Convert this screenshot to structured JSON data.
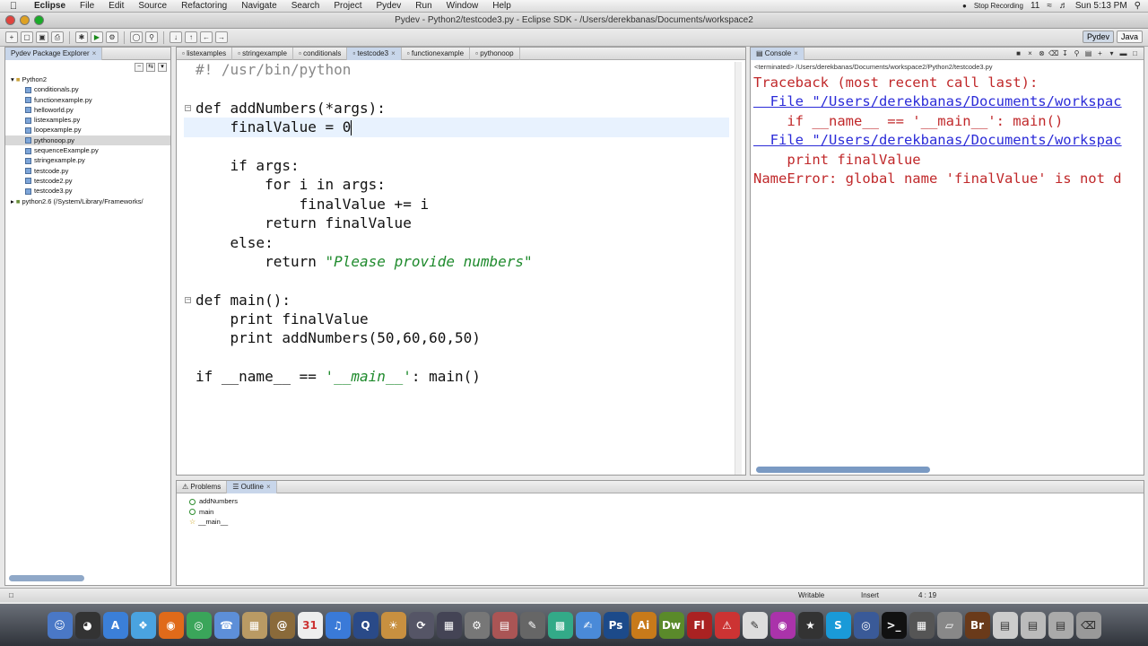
{
  "menubar": {
    "app": "Eclipse",
    "items": [
      "File",
      "Edit",
      "Source",
      "Refactoring",
      "Navigate",
      "Search",
      "Project",
      "Pydev",
      "Run",
      "Window",
      "Help"
    ],
    "recording": "Stop Recording",
    "badge": "11",
    "clock": "Sun 5:13 PM"
  },
  "window": {
    "title": "Pydev - Python2/testcode3.py - Eclipse SDK - /Users/derekbanas/Documents/workspace2"
  },
  "perspectives": [
    "Pydev",
    "Java"
  ],
  "explorer": {
    "tab": "Pydev Package Explorer",
    "project": "Python2",
    "files": [
      "conditionals.py",
      "functionexample.py",
      "helloworld.py",
      "listexamples.py",
      "loopexample.py",
      "pythonoop.py",
      "sequenceExample.py",
      "stringexample.py",
      "testcode.py",
      "testcode2.py",
      "testcode3.py"
    ],
    "selected": "pythonoop.py",
    "library": "python2.6  (/System/Library/Frameworks/"
  },
  "editor": {
    "tabs": [
      "listexamples",
      "stringexample",
      "conditionals",
      "testcode3",
      "functionexample",
      "pythonoop"
    ],
    "active_tab": "testcode3",
    "lines": {
      "l1": "#! /usr/bin/python",
      "l3a": "def addNumbers(*args):",
      "l4": "    finalValue = 0",
      "l6": "    if args:",
      "l7": "        for i in args:",
      "l8": "            finalValue += i",
      "l9": "        return finalValue",
      "l10": "    else:",
      "l11a": "        return ",
      "l11b": "\"Please provide numbers\"",
      "l13": "def main():",
      "l14": "    print finalValue",
      "l15": "    print addNumbers(50,60,60,50)",
      "l17a": "if __name__ == ",
      "l17b": "'__main__'",
      "l17c": ": main()"
    }
  },
  "console": {
    "tab": "Console",
    "path": "<terminated> /Users/derekbanas/Documents/workspace2/Python2/testcode3.py",
    "lines": {
      "c1": "Traceback (most recent call last):",
      "c2": "  File \"/Users/derekbanas/Documents/workspac",
      "c3": "    if __name__ == '__main__': main()",
      "c4": "  File \"/Users/derekbanas/Documents/workspac",
      "c5": "    print finalValue",
      "c6": "NameError: global name 'finalValue' is not d"
    }
  },
  "outline": {
    "tabs": [
      "Problems",
      "Outline"
    ],
    "items": [
      "addNumbers",
      "main",
      "__main__"
    ]
  },
  "statusbar": {
    "writable": "Writable",
    "mode": "Insert",
    "position": "4 : 19"
  }
}
